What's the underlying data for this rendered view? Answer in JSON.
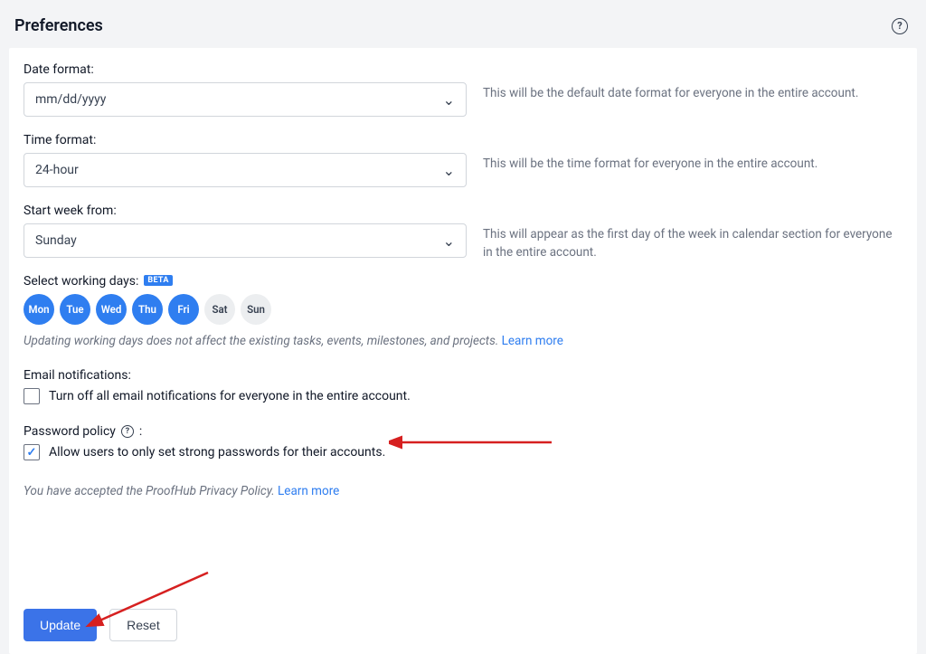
{
  "header": {
    "title": "Preferences"
  },
  "date_format": {
    "label": "Date format:",
    "value": "mm/dd/yyyy",
    "desc": "This will be the default date format for everyone in the entire account."
  },
  "time_format": {
    "label": "Time format:",
    "value": "24-hour",
    "desc": "This will be the time format for everyone in the entire account."
  },
  "start_week": {
    "label": "Start week from:",
    "value": "Sunday",
    "desc": "This will appear as the first day of the week in calendar section for everyone in the entire account."
  },
  "working_days": {
    "label": "Select working days:",
    "badge": "BETA",
    "days": [
      {
        "short": "Mon",
        "on": true
      },
      {
        "short": "Tue",
        "on": true
      },
      {
        "short": "Wed",
        "on": true
      },
      {
        "short": "Thu",
        "on": true
      },
      {
        "short": "Fri",
        "on": true
      },
      {
        "short": "Sat",
        "on": false
      },
      {
        "short": "Sun",
        "on": false
      }
    ],
    "hint": "Updating working days does not affect the existing tasks, events, milestones, and projects. ",
    "learn": "Learn more"
  },
  "email": {
    "label": "Email notifications:",
    "option": "Turn off all email notifications for everyone in the entire account.",
    "checked": false
  },
  "password": {
    "label": "Password policy ",
    "colon": ":",
    "option": "Allow users to only set strong passwords for their accounts.",
    "checked": true,
    "help_char": "?"
  },
  "privacy": {
    "text": "You have accepted the ProofHub Privacy Policy. ",
    "learn": "Learn more"
  },
  "buttons": {
    "update": "Update",
    "reset": "Reset"
  }
}
